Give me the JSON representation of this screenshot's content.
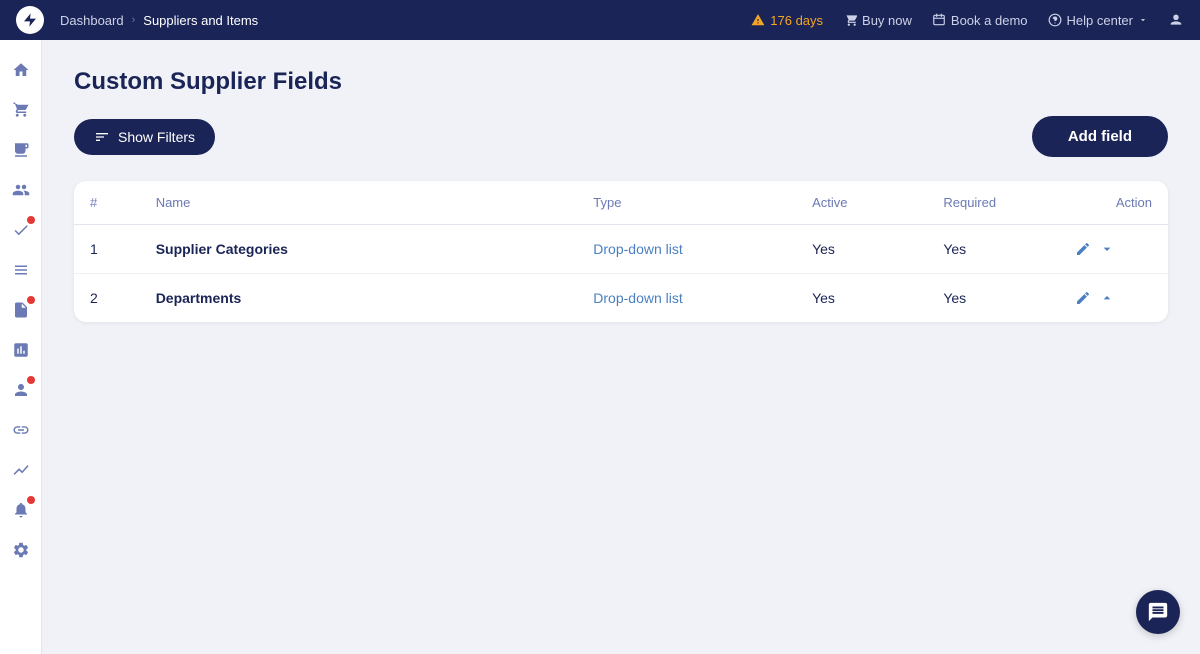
{
  "topnav": {
    "breadcrumb_home": "Dashboard",
    "breadcrumb_sep": "›",
    "breadcrumb_current": "Suppliers and Items",
    "trial_label": "176 days",
    "buy_now": "Buy now",
    "book_demo": "Book a demo",
    "help_center": "Help center"
  },
  "sidebar": {
    "icons": [
      {
        "name": "home-icon",
        "symbol": "⌂",
        "badge": false
      },
      {
        "name": "orders-icon",
        "symbol": "🛒",
        "badge": false
      },
      {
        "name": "receive-icon",
        "symbol": "📦",
        "badge": false
      },
      {
        "name": "suppliers-icon",
        "symbol": "👤",
        "badge": false
      },
      {
        "name": "tasks-icon",
        "symbol": "✓",
        "badge": true
      },
      {
        "name": "catalog-icon",
        "symbol": "📋",
        "badge": false
      },
      {
        "name": "contracts-icon",
        "symbol": "📄",
        "badge": true
      },
      {
        "name": "reports-icon",
        "symbol": "📊",
        "badge": false
      },
      {
        "name": "team-icon",
        "symbol": "👥",
        "badge": true
      },
      {
        "name": "integrations-icon",
        "symbol": "🔗",
        "badge": false
      },
      {
        "name": "analytics-icon",
        "symbol": "📈",
        "badge": false
      },
      {
        "name": "notifications-icon",
        "symbol": "🔔",
        "badge": true
      },
      {
        "name": "settings-icon",
        "symbol": "⚙",
        "badge": false
      }
    ]
  },
  "page": {
    "title": "Custom Supplier Fields",
    "show_filters_label": "Show Filters",
    "add_field_label": "Add field"
  },
  "table": {
    "columns": [
      "#",
      "Name",
      "Type",
      "Active",
      "Required",
      "Action"
    ],
    "rows": [
      {
        "num": "1",
        "name": "Supplier Categories",
        "type": "Drop-down list",
        "active": "Yes",
        "required": "Yes"
      },
      {
        "num": "2",
        "name": "Departments",
        "type": "Drop-down list",
        "active": "Yes",
        "required": "Yes"
      }
    ]
  }
}
